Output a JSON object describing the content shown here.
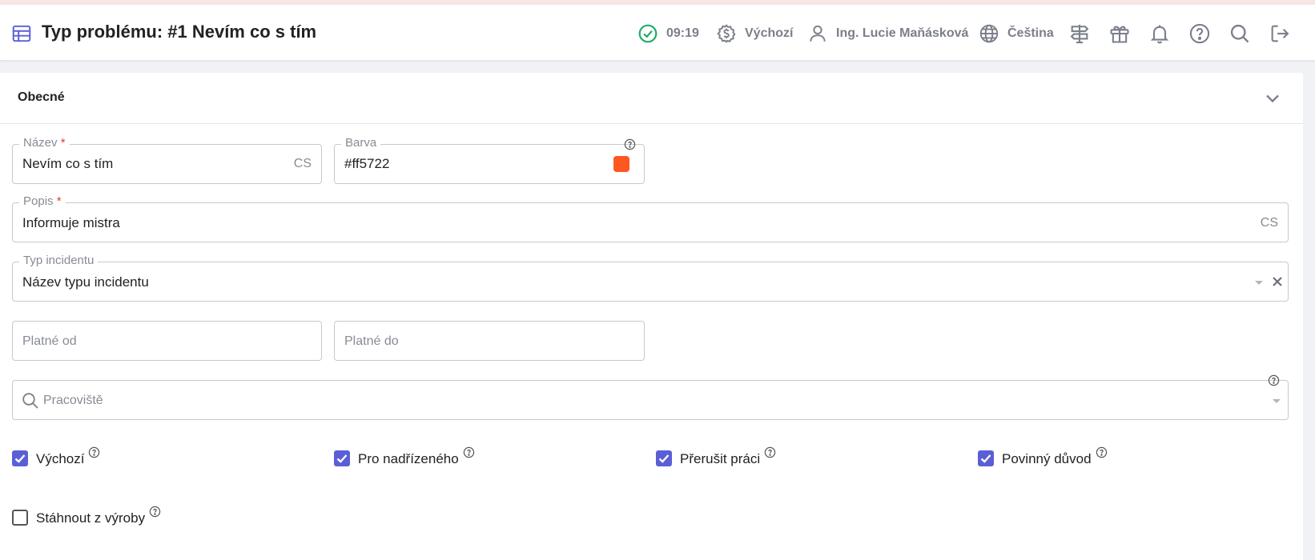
{
  "header": {
    "title": "Typ problému: #1 Nevím co s tím",
    "time": "09:19",
    "currency": "Výchozí",
    "user": "Ing. Lucie Maňásková",
    "language": "Čeština",
    "icons": [
      "table-icon",
      "check-circle-icon",
      "currency-icon",
      "user-icon",
      "globe-icon",
      "signpost-icon",
      "gift-icon",
      "bell-icon",
      "help-icon",
      "search-icon",
      "logout-icon"
    ]
  },
  "section": {
    "title": "Obecné"
  },
  "form": {
    "name": {
      "label": "Název",
      "required": "*",
      "value": "Nevím co s tím",
      "lang": "CS"
    },
    "color": {
      "label": "Barva",
      "value": "#ff5722",
      "swatch": "#ff5722"
    },
    "description": {
      "label": "Popis",
      "required": "*",
      "value": "Informuje mistra",
      "lang": "CS"
    },
    "incident_type": {
      "label": "Typ incidentu",
      "value": "Název typu incidentu"
    },
    "valid_from": {
      "placeholder": "Platné od"
    },
    "valid_to": {
      "placeholder": "Platné do"
    },
    "workplace": {
      "placeholder": "Pracoviště"
    }
  },
  "checkboxes": [
    {
      "label": "Výchozí",
      "checked": true
    },
    {
      "label": "Pro nadřízeného",
      "checked": true
    },
    {
      "label": "Přerušit práci",
      "checked": true
    },
    {
      "label": "Povinný důvod",
      "checked": true
    },
    {
      "label": "Stáhnout z výroby",
      "checked": false
    }
  ],
  "colors": {
    "accent": "#5a5fd6",
    "success": "#1faa6b",
    "muted": "#7b7f8a"
  }
}
